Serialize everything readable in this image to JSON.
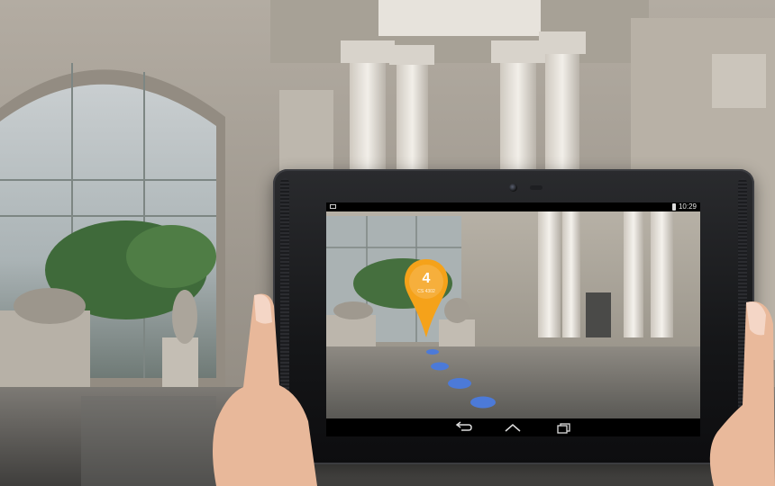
{
  "status_bar": {
    "time": "10:29",
    "notification_icon": "image-icon",
    "battery_icon": "battery-icon"
  },
  "waypoint": {
    "number": "4",
    "label": "CS 4302",
    "icon": "map-pin-icon",
    "color": "#f5a21a"
  },
  "path_dots_color": "#4c7ad8",
  "nav_bar": {
    "back_icon": "back-icon",
    "home_icon": "home-icon",
    "recents_icon": "recents-icon"
  }
}
